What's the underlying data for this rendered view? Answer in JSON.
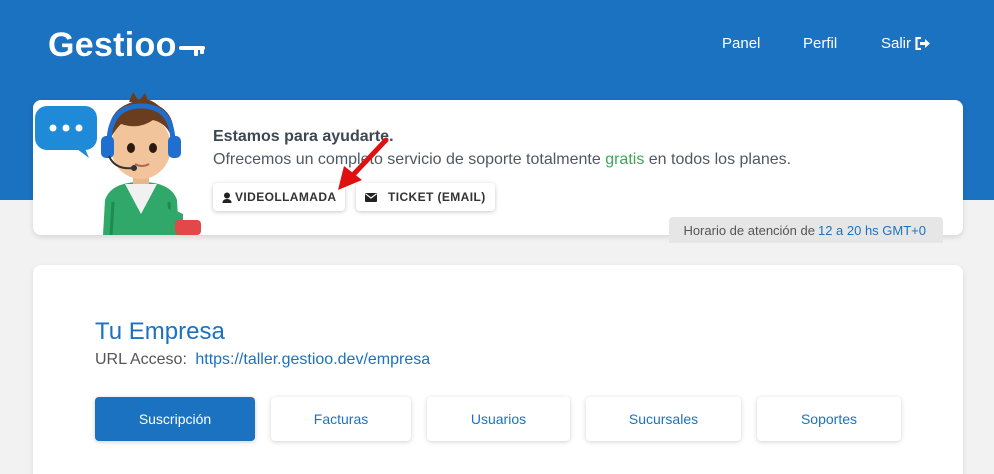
{
  "header": {
    "logo_text": "Gestioo",
    "nav": [
      {
        "label": "Panel"
      },
      {
        "label": "Perfil"
      },
      {
        "label": "Salir"
      }
    ]
  },
  "support": {
    "title": "Estamos para ayudarte.",
    "desc_pre": "Ofrecemos un completo servicio de soporte totalmente",
    "desc_highlight": "gratis",
    "desc_post": "en todos los planes.",
    "buttons": [
      {
        "label": "VIDEOLLAMADA",
        "icon": "user-headset-icon"
      },
      {
        "label": "TICKET (EMAIL)",
        "icon": "envelope-icon"
      }
    ],
    "hours_pre": "Horario de atención de",
    "hours_highlight": "12 a 20 hs GMT+0"
  },
  "company": {
    "title": "Tu Empresa",
    "url_label": "URL Acceso:",
    "url": "https://taller.gestioo.dev/empresa",
    "tabs": [
      {
        "label": "Suscripción",
        "active": true
      },
      {
        "label": "Facturas"
      },
      {
        "label": "Usuarios"
      },
      {
        "label": "Sucursales"
      },
      {
        "label": "Soportes"
      }
    ]
  },
  "colors": {
    "brand": "#1b72c0",
    "highlight_green": "#3aa856",
    "annotation_arrow": "#e01010"
  }
}
